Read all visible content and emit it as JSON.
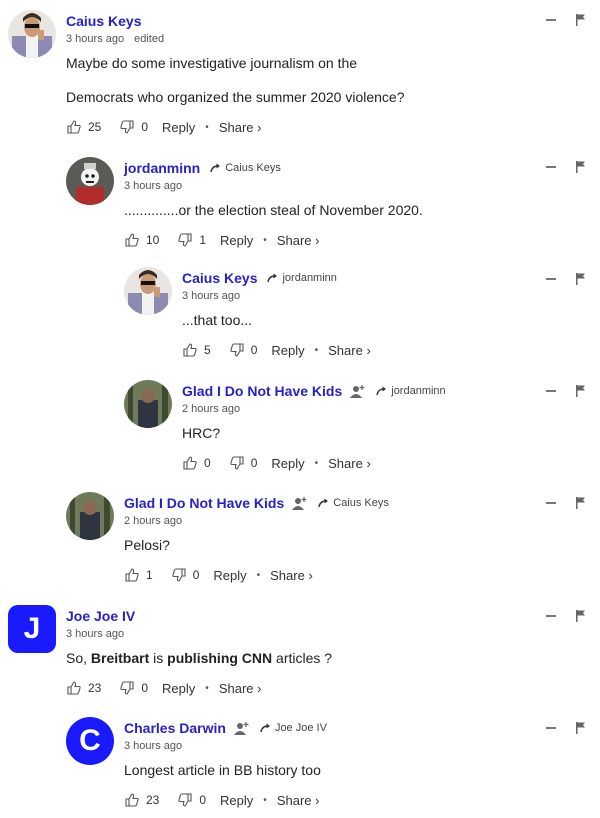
{
  "comments": [
    {
      "author": "Caius Keys",
      "time": "3 hours ago",
      "edited": "edited",
      "reply_to": "",
      "text": [
        "Maybe do some investigative journalism on the",
        "Democrats who organized the summer 2020 violence?"
      ],
      "likes": "25",
      "dislikes": "0"
    },
    {
      "author": "jordanminn",
      "time": "3 hours ago",
      "reply_to": "Caius Keys",
      "text": [
        "..............or the election steal of November 2020."
      ],
      "likes": "10",
      "dislikes": "1"
    },
    {
      "author": "Caius Keys",
      "time": "3 hours ago",
      "reply_to": "jordanminn",
      "text": [
        "...that too..."
      ],
      "likes": "5",
      "dislikes": "0"
    },
    {
      "author": "Glad I Do Not Have Kids",
      "time": "2 hours ago",
      "reply_to": "jordanminn",
      "text": [
        "HRC?"
      ],
      "likes": "0",
      "dislikes": "0"
    },
    {
      "author": "Glad I Do Not Have Kids",
      "time": "2 hours ago",
      "reply_to": "Caius Keys",
      "text": [
        "Pelosi?"
      ],
      "likes": "1",
      "dislikes": "0"
    },
    {
      "author": "Joe Joe IV",
      "time": "3 hours ago",
      "reply_to": "",
      "avatar_letter": "J",
      "text_parts": [
        "So, ",
        "Breitbart",
        " is ",
        "publishing CNN",
        " articles ?"
      ],
      "likes": "23",
      "dislikes": "0"
    },
    {
      "author": "Charles Darwin",
      "time": "3 hours ago",
      "reply_to": "Joe Joe IV",
      "avatar_letter": "C",
      "text": [
        "Longest article in BB history too"
      ],
      "likes": "23",
      "dislikes": "0"
    }
  ],
  "labels": {
    "reply": "Reply",
    "share": "Share ›",
    "dot": "•"
  },
  "icons": [
    "thumbs-up-icon",
    "thumbs-down-icon",
    "reply-arrow-icon",
    "follow-user-icon",
    "minimize-icon",
    "flag-icon"
  ],
  "colors": {
    "author": "#2323c8",
    "avatar_letter_bg": "#1a1aff"
  }
}
